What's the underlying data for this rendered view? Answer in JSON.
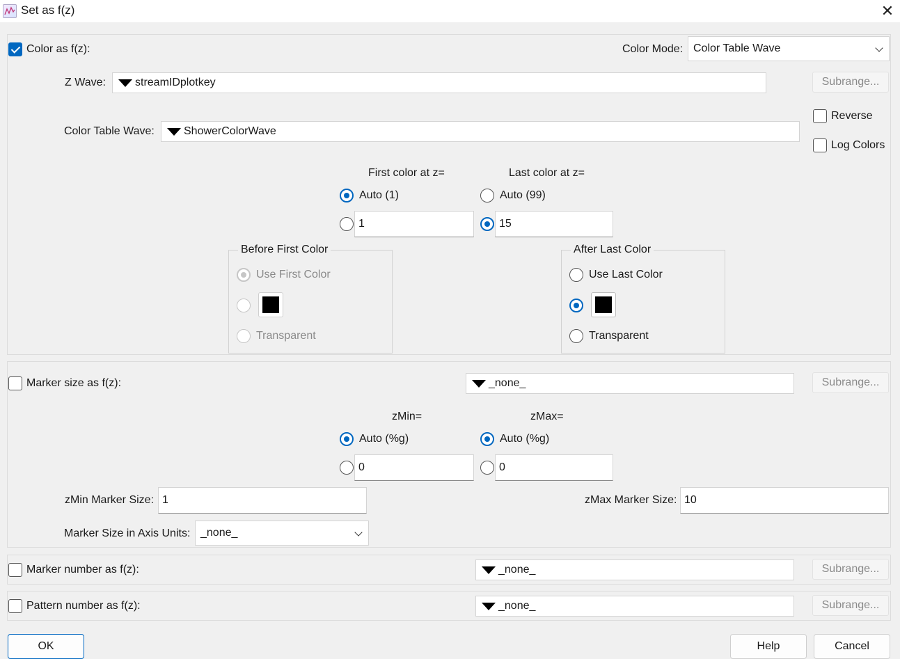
{
  "window": {
    "title": "Set as f(z)"
  },
  "color_section": {
    "checkbox_label": "Color as f(z):",
    "checked": true,
    "color_mode_label": "Color Mode:",
    "color_mode_value": "Color Table Wave",
    "z_wave_label": "Z Wave:",
    "z_wave_value": "streamIDplotkey",
    "subrange_label": "Subrange...",
    "color_table_wave_label": "Color Table Wave:",
    "color_table_wave_value": "ShowerColorWave",
    "reverse_label": "Reverse",
    "log_colors_label": "Log Colors",
    "first_color_header": "First color at z=",
    "last_color_header": "Last color at z=",
    "first_auto_label": "Auto (1)",
    "first_value": "1",
    "last_auto_label": "Auto (99)",
    "last_value": "15",
    "before_group": {
      "title": "Before First Color",
      "use_first_label": "Use First Color",
      "transparent_label": "Transparent"
    },
    "after_group": {
      "title": "After Last Color",
      "use_last_label": "Use Last Color",
      "transparent_label": "Transparent"
    },
    "swatch_color": "#000000"
  },
  "marker_size_section": {
    "checkbox_label": "Marker size as f(z):",
    "wave_value": "_none_",
    "subrange_label": "Subrange...",
    "zmin_header": "zMin=",
    "zmax_header": "zMax=",
    "zmin_auto_label": "Auto (%g)",
    "zmin_value": "0",
    "zmax_auto_label": "Auto (%g)",
    "zmax_value": "0",
    "zmin_marker_size_label": "zMin Marker Size:",
    "zmin_marker_size_value": "1",
    "zmax_marker_size_label": "zMax Marker Size:",
    "zmax_marker_size_value": "10",
    "axis_units_label": "Marker Size in Axis Units:",
    "axis_units_value": "_none_"
  },
  "marker_number_section": {
    "checkbox_label": "Marker number as f(z):",
    "wave_value": "_none_",
    "subrange_label": "Subrange..."
  },
  "pattern_number_section": {
    "checkbox_label": "Pattern number as f(z):",
    "wave_value": "_none_",
    "subrange_label": "Subrange..."
  },
  "buttons": {
    "ok": "OK",
    "help": "Help",
    "cancel": "Cancel"
  },
  "colors": {
    "accent": "#0067c0",
    "background": "#f0f0f0",
    "disabled_text": "#8a8a8a"
  }
}
